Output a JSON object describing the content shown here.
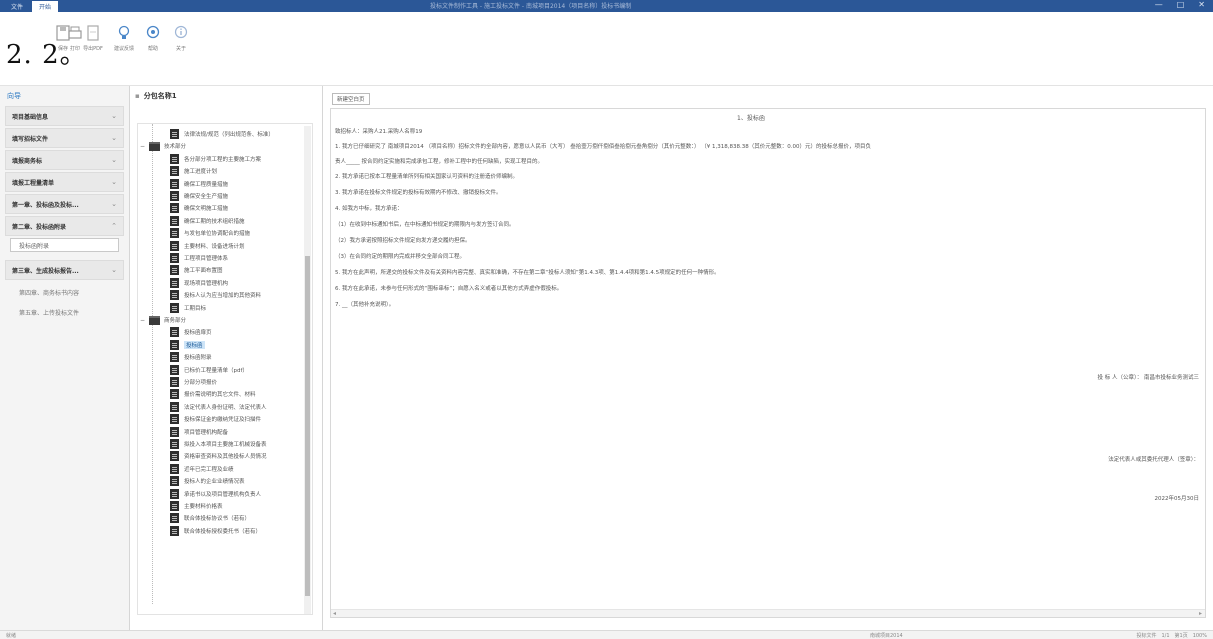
{
  "titlebar": {
    "tabs": [
      "文件",
      "开始"
    ],
    "title": "投标文件制作工具 - 施工投标文件 - 南城项目2014（项目名称）投标书编制",
    "window_buttons": [
      "—",
      "□",
      "✕"
    ]
  },
  "ribbon": {
    "big_label": "2. 2。",
    "buttons": [
      {
        "label": "保存"
      },
      {
        "label": "打印"
      },
      {
        "label": "导出PDF"
      },
      {
        "label": "建议反馈"
      },
      {
        "label": "帮助"
      },
      {
        "label": "关于"
      }
    ]
  },
  "sidebar": {
    "header": "向导",
    "items": [
      {
        "label": "项目基础信息"
      },
      {
        "label": "填写招标文件"
      },
      {
        "label": "填报商务标"
      },
      {
        "label": "填报工程量清单"
      },
      {
        "label": "第一章、投标函及投标..."
      },
      {
        "label": "第二章、投标函附录"
      },
      {
        "label": "第三章、生成投标报告..."
      }
    ],
    "sub_item": "投标函附录",
    "plain_items": [
      "第四章、商务标书内容",
      "第五章、上传投标文件"
    ]
  },
  "tree": {
    "header": "分包名称1",
    "nodes": [
      {
        "label": "法律法规/规范（列出规范条、标准）",
        "type": "doc",
        "x": 38
      },
      {
        "label": "技术部分",
        "type": "folder",
        "x": 8
      },
      {
        "label": "各分部分项工程的主要施工方案",
        "type": "doc",
        "x": 38
      },
      {
        "label": "施工进度计划",
        "type": "doc",
        "x": 38
      },
      {
        "label": "确保工程质量措施",
        "type": "doc",
        "x": 38
      },
      {
        "label": "确保安全生产措施",
        "type": "doc",
        "x": 38
      },
      {
        "label": "确保文明施工措施",
        "type": "doc",
        "x": 38
      },
      {
        "label": "确保工期的技术组织措施",
        "type": "doc",
        "x": 38
      },
      {
        "label": "与发包单位协调配合的措施",
        "type": "doc",
        "x": 38
      },
      {
        "label": "主要材料、设备进场计划",
        "type": "doc",
        "x": 38
      },
      {
        "label": "工程项目管理体系",
        "type": "doc",
        "x": 38
      },
      {
        "label": "施工平面布置图",
        "type": "doc",
        "x": 38
      },
      {
        "label": "现场项目管理机构",
        "type": "doc",
        "x": 38
      },
      {
        "label": "投标人认为应当增加的其他资料",
        "type": "doc",
        "x": 38
      },
      {
        "label": "工期目标",
        "type": "doc",
        "x": 38
      },
      {
        "label": "商务部分",
        "type": "folder",
        "x": 8
      },
      {
        "label": "投标函扉页",
        "type": "doc",
        "x": 38
      },
      {
        "label": "投标函",
        "type": "doc",
        "x": 38,
        "selected": true
      },
      {
        "label": "投标函附录",
        "type": "doc",
        "x": 38
      },
      {
        "label": "已标价工程量清单（pdf）",
        "type": "doc",
        "x": 38
      },
      {
        "label": "分部分项报价",
        "type": "doc",
        "x": 38
      },
      {
        "label": "报价需说明的其它文件、材料",
        "type": "doc",
        "x": 38
      },
      {
        "label": "法定代表人身份证明、法定代表人",
        "type": "doc",
        "x": 38
      },
      {
        "label": "投标保证金的缴纳凭证及扫描件",
        "type": "doc",
        "x": 38
      },
      {
        "label": "项目管理机构配备",
        "type": "doc",
        "x": 38
      },
      {
        "label": "拟投入本项目主要施工机械设备表",
        "type": "doc",
        "x": 38
      },
      {
        "label": "资格审查资料及其他投标人员情况",
        "type": "doc",
        "x": 38
      },
      {
        "label": "近年已完工程及业绩",
        "type": "doc",
        "x": 38
      },
      {
        "label": "投标人的企业业绩情况表",
        "type": "doc",
        "x": 38
      },
      {
        "label": "承诺书以及项目管理机构负责人",
        "type": "doc",
        "x": 38
      },
      {
        "label": "主要材料价格表",
        "type": "doc",
        "x": 38
      },
      {
        "label": "联合体投标协议书（若有）",
        "type": "doc",
        "x": 38
      },
      {
        "label": "联合体投标授权委托书（若有）",
        "type": "doc",
        "x": 38
      }
    ]
  },
  "content": {
    "tab_label": "新建空白页",
    "doc_title": "1、投标函",
    "lines": [
      "致招标人：采购人21.采购人名称19",
      "1. 我方已仔细研究了 南城项目2014 （项目名称）招标文件的全部内容，愿意以人民币（大写） 叁拾壹万捌仟捌佰叁拾捌元叁角捌分（其价元整数：） （¥ 1,318,838.38（其价元整数：0.00）元）的投标总报价，项目负",
      "责人_____ 按合同约定实施和完成承包工程，修补工程中的任何缺陷，实现工程目的。",
      "2. 我方承诺已按本工程量清单所列有相关国家认可资料的注册造价师编制。",
      "3. 我方承诺在投标文件规定的投标有效期内不修改、撤销投标文件。",
      "4. 如我方中标，我方承诺：",
      "（1）在收到中标通知书后，在中标通知书规定的期限内与发方签订合同。",
      "（2）我方承诺按照招标文件规定向发方递交履约担保。",
      "（3）在合同约定的期限内完成并移交全部合同工程。",
      "5. 我方在此声明，所递交的投标文件及有关资料内容完整、真实和准确，不存在第二章“投标人须知”第1.4.3项、第1.4.4项和第1.4.5项规定的任何一种情形。",
      "6. 我方在此承诺，未参与任何形式的“围标串标”；自愿入名义或者以其他方式弄虚作假投标。",
      "7. __（其他补充说明）。"
    ],
    "sig_bidder": "投 标 人（公章）： 南昌市投标业务测试三",
    "sig_rep": "法定代表人或其委托代理人（签章）：",
    "sig_date": "2022年05月30日"
  },
  "statusbar": {
    "left": "就绪",
    "middle": "南城项目2014",
    "right": "投标文件　1/1　第1页　100%"
  }
}
